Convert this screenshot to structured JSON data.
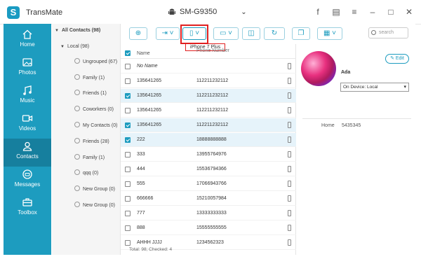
{
  "app": {
    "title": "TransMate",
    "logo_letter": "S"
  },
  "device": {
    "name": "SM-G9350"
  },
  "window_icons": [
    "facebook-icon",
    "feedback-icon",
    "menu-icon",
    "minimize-icon",
    "maximize-icon",
    "close-icon"
  ],
  "nav": {
    "items": [
      {
        "label": "Home",
        "icon": "home-icon"
      },
      {
        "label": "Photos",
        "icon": "photos-icon"
      },
      {
        "label": "Music",
        "icon": "music-icon"
      },
      {
        "label": "Videos",
        "icon": "videos-icon"
      },
      {
        "label": "Contacts",
        "icon": "contacts-icon",
        "active": true
      },
      {
        "label": "Messages",
        "icon": "messages-icon"
      },
      {
        "label": "Toolbox",
        "icon": "toolbox-icon"
      }
    ]
  },
  "tree": {
    "all_contacts": "All Contacts  (98)",
    "local": "Local  (98)",
    "groups": [
      {
        "name": "Ungrouped",
        "count": "(67)"
      },
      {
        "name": "Family",
        "count": "(1)"
      },
      {
        "name": "Friends",
        "count": "(1)"
      },
      {
        "name": "Coworkers",
        "count": "(0)"
      },
      {
        "name": "My Contacts",
        "count": "(0)"
      },
      {
        "name": "Friends",
        "count": "(28)"
      },
      {
        "name": "Family",
        "count": "(1)"
      },
      {
        "name": "qqq",
        "count": "(0)"
      },
      {
        "name": "New Group",
        "count": "(0)"
      },
      {
        "name": "New Group",
        "count": "(0)"
      }
    ]
  },
  "toolbar": {
    "buttons": [
      "add-icon",
      "import-icon",
      "export-to-device-icon",
      "export-to-pc-icon",
      "delete-icon",
      "refresh-icon",
      "duplicate-icon",
      "toolbox-icon"
    ],
    "tooltip": "iPhone 7 Plus",
    "search_placeholder": "search"
  },
  "list": {
    "col_name": "Name",
    "col_phone": "Phone Number",
    "rows": [
      {
        "name": "No Name",
        "phone": "",
        "checked": false,
        "italic": true
      },
      {
        "name": "135641265",
        "phone": "112211232112",
        "checked": false
      },
      {
        "name": "135641265",
        "phone": "112211232112",
        "checked": true
      },
      {
        "name": "135641265",
        "phone": "112211232112",
        "checked": false
      },
      {
        "name": "135641265",
        "phone": "112211232112",
        "checked": true
      },
      {
        "name": "222",
        "phone": "18888888888",
        "checked": true
      },
      {
        "name": "333",
        "phone": "13955764976",
        "checked": false
      },
      {
        "name": "444",
        "phone": "15536794366",
        "checked": false
      },
      {
        "name": "555",
        "phone": "17066943766",
        "checked": false
      },
      {
        "name": "666666",
        "phone": "15210057984",
        "checked": false
      },
      {
        "name": "777",
        "phone": "13333333333",
        "checked": false
      },
      {
        "name": "888",
        "phone": "15555555555",
        "checked": false
      },
      {
        "name": "AHHH JJJJ",
        "phone": "1234562323",
        "checked": false
      }
    ],
    "footer": "Total: 98; Checked: 4"
  },
  "detail": {
    "edit_label": "Edit",
    "name": "Ada",
    "on_device": "On Device: Local",
    "field_label": "Home",
    "field_value": "5435345"
  }
}
